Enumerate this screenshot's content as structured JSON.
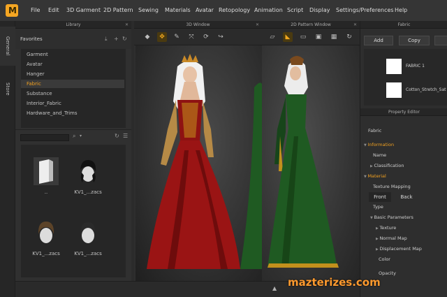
{
  "menu": {
    "items": [
      "File",
      "Edit",
      "3D Garment",
      "2D Pattern",
      "Sewing",
      "Materials",
      "Avatar",
      "Retopology",
      "Animation",
      "Script",
      "Display",
      "Settings/Preferences",
      "Help"
    ]
  },
  "side_tabs": {
    "general": "General",
    "store": "Store"
  },
  "library": {
    "title": "Library",
    "favorites_label": "Favorites",
    "tree": [
      "Garment",
      "Avatar",
      "Hanger",
      "Fabric",
      "Substance",
      "Interior_Fabric",
      "Hardware_and_Trims"
    ],
    "selected": "Fabric",
    "thumbnails": [
      {
        "icon": "folder-icon",
        "caption": ".."
      },
      {
        "icon": "hair-icon",
        "caption": "KV1_...zacs"
      },
      {
        "icon": "hair-icon",
        "caption": "KV1_...zacs"
      },
      {
        "icon": "hair-icon",
        "caption": "KV1_...zacs"
      }
    ]
  },
  "window3d": {
    "title": "3D Window"
  },
  "window2d": {
    "title": "2D Pattern Window"
  },
  "fabric_panel": {
    "title": "Fabric",
    "add_label": "Add",
    "copy_label": "Copy",
    "items": [
      {
        "name": "FABRIC 1",
        "color": "#ffffff"
      },
      {
        "name": "Cotton_Stretch_Sat",
        "color": "#ffffff"
      }
    ]
  },
  "property_editor": {
    "title": "Property Editor",
    "header": "Fabric",
    "information": "Information",
    "name": "Name",
    "classification": "Classification",
    "material": "Material",
    "texture_mapping": "Texture Mapping",
    "front": "Front",
    "back": "Back",
    "type": "Type",
    "basic_parameters": "Basic Parameters",
    "texture": "Texture",
    "normal_map": "Normal Map",
    "displacement_map": "Displacement Map",
    "color": "Color",
    "opacity": "Opacity"
  },
  "colors": {
    "accent": "#f0a020",
    "red_dress": "#9a1414",
    "green_dress": "#1f5a22"
  },
  "watermark": "mazterizes.com"
}
